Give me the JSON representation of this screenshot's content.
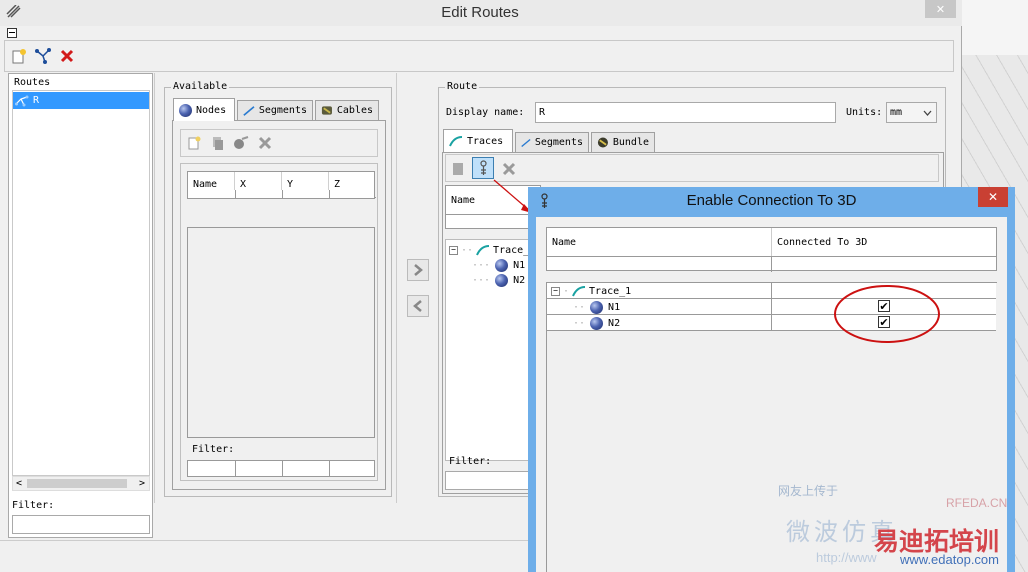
{
  "window": {
    "title": "Edit Routes",
    "close_glyph": "✕"
  },
  "routes": {
    "header": "Routes",
    "items": [
      "R"
    ],
    "filter_label": "Filter:"
  },
  "available": {
    "group_label": "Available",
    "tabs": [
      "Nodes",
      "Segments",
      "Cables"
    ],
    "columns": [
      "Name",
      "X",
      "Y",
      "Z"
    ],
    "filter_label": "Filter:"
  },
  "route": {
    "group_label": "Route",
    "display_name_label": "Display name:",
    "display_name_value": "R",
    "units_label": "Units:",
    "units_value": "mm",
    "tabs": [
      "Traces",
      "Segments",
      "Bundle"
    ],
    "list_header": "Name",
    "tree": {
      "trace": "Trace_1",
      "nodes": [
        "N1",
        "N2"
      ]
    },
    "filter_label": "Filter:"
  },
  "dialog": {
    "title": "Enable Connection To 3D",
    "close_glyph": "✕",
    "columns": [
      "Name",
      "Connected To 3D"
    ],
    "tree": {
      "trace": "Trace_1",
      "nodes": [
        {
          "name": "N1",
          "connected": true
        },
        {
          "name": "N2",
          "connected": true
        }
      ]
    }
  },
  "watermark": {
    "line1": "网友上传于",
    "line2": "微波仿真",
    "line3": "http://www",
    "brand": "RFEDA.CN",
    "site_cn": "易迪拓培训",
    "site_url": "www.edatop.com"
  },
  "colors": {
    "selection": "#3399ff",
    "dialog_frame": "#6eaee9",
    "close_red": "#c94033",
    "annotation_red": "#cc1111"
  }
}
